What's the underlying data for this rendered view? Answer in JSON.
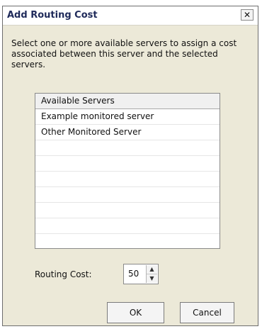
{
  "dialog": {
    "title": "Add Routing Cost",
    "close_glyph": "✕",
    "description": "Select one or more available servers to assign a cost associated between this server and the selected servers."
  },
  "list": {
    "header": "Available Servers",
    "items": [
      "Example monitored server",
      "Other Monitored Server",
      "",
      "",
      "",
      "",
      "",
      "",
      ""
    ]
  },
  "routing": {
    "label": "Routing Cost:",
    "value": "50",
    "up_glyph": "▲",
    "down_glyph": "▼"
  },
  "buttons": {
    "ok": "OK",
    "cancel": "Cancel"
  }
}
